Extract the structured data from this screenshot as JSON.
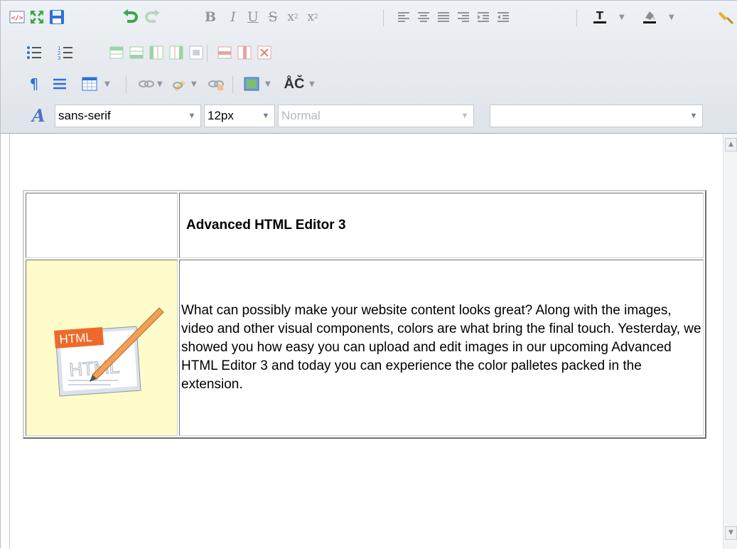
{
  "toolbar": {
    "row1": [
      "source-icon",
      "fullscreen-icon",
      "save-icon",
      "undo-icon",
      "redo-icon",
      "bold-icon",
      "italic-icon",
      "underline-icon",
      "strikethrough-icon",
      "subscript-icon",
      "superscript-icon",
      "align-left-icon",
      "align-center-icon",
      "align-justify-icon",
      "align-right-icon",
      "indent-icon",
      "outdent-icon",
      "text-color-icon",
      "background-color-icon",
      "clear-format-icon"
    ],
    "row2": [
      "bullet-list-icon",
      "numbered-list-icon",
      "insert-row-above-icon",
      "insert-row-below-icon",
      "insert-column-left-icon",
      "insert-column-right-icon",
      "merge-cells-icon",
      "delete-row-icon",
      "delete-column-icon",
      "delete-table-icon"
    ],
    "row3": [
      "paragraph-icon",
      "horizontal-rule-icon",
      "insert-table-icon",
      "insert-link-icon",
      "edit-link-icon",
      "unlink-icon",
      "insert-image-icon",
      "special-characters-icon"
    ],
    "special_chars_label": "ÅČ",
    "font_family": "sans-serif",
    "font_size": "12px",
    "format_block": "Normal",
    "style_select": ""
  },
  "document": {
    "title": "Advanced HTML Editor 3",
    "image_label_top": "HTML",
    "image_label_bottom": "HTML",
    "body": " What can possibly make your website content looks great? Along with the images, video and other visual components, colors are what bring the final touch. Yesterday, we showed you how easy you can upload and edit images in our upcoming Advanced HTML Editor 3 and today you can experience the color palletes packed in the extension."
  },
  "colors": {
    "toolbar_bg": "#e6eaef",
    "image_cell_bg": "#fdfcca",
    "accent_green": "#3aa84a",
    "accent_blue": "#2f6fd8",
    "accent_red": "#e05a4a"
  }
}
